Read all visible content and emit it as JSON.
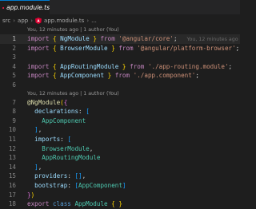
{
  "tab": {
    "filename": "app.module.ts"
  },
  "breadcrumb": {
    "parts": [
      "src",
      "app",
      "app.module.ts",
      "..."
    ]
  },
  "codelens": {
    "top": "You, 12 minutes ago | 1 author (You)",
    "middle": "You, 12 minutes ago | 1 author (You)"
  },
  "blame_inline": "You, 12 minutes ago",
  "lines": [
    {
      "n": "1",
      "tokens": [
        [
          "kw",
          "import"
        ],
        [
          "punc",
          " "
        ],
        [
          "br",
          "{"
        ],
        [
          "punc",
          " "
        ],
        [
          "id",
          "NgModule"
        ],
        [
          "punc",
          " "
        ],
        [
          "br",
          "}"
        ],
        [
          "punc",
          " "
        ],
        [
          "kw",
          "from"
        ],
        [
          "punc",
          " "
        ],
        [
          "str",
          "'@angular/core'"
        ],
        [
          "punc",
          ";"
        ]
      ]
    },
    {
      "n": "2",
      "tokens": [
        [
          "kw",
          "import"
        ],
        [
          "punc",
          " "
        ],
        [
          "br",
          "{"
        ],
        [
          "punc",
          " "
        ],
        [
          "id",
          "BrowserModule"
        ],
        [
          "punc",
          " "
        ],
        [
          "br",
          "}"
        ],
        [
          "punc",
          " "
        ],
        [
          "kw",
          "from"
        ],
        [
          "punc",
          " "
        ],
        [
          "str",
          "'@angular/platform-browser'"
        ],
        [
          "punc",
          ";"
        ]
      ]
    },
    {
      "n": "3",
      "tokens": []
    },
    {
      "n": "4",
      "tokens": [
        [
          "kw",
          "import"
        ],
        [
          "punc",
          " "
        ],
        [
          "br",
          "{"
        ],
        [
          "punc",
          " "
        ],
        [
          "id",
          "AppRoutingModule"
        ],
        [
          "punc",
          " "
        ],
        [
          "br",
          "}"
        ],
        [
          "punc",
          " "
        ],
        [
          "kw",
          "from"
        ],
        [
          "punc",
          " "
        ],
        [
          "str",
          "'./app-routing.module'"
        ],
        [
          "punc",
          ";"
        ]
      ]
    },
    {
      "n": "5",
      "tokens": [
        [
          "kw",
          "import"
        ],
        [
          "punc",
          " "
        ],
        [
          "br",
          "{"
        ],
        [
          "punc",
          " "
        ],
        [
          "id",
          "AppComponent"
        ],
        [
          "punc",
          " "
        ],
        [
          "br",
          "}"
        ],
        [
          "punc",
          " "
        ],
        [
          "kw",
          "from"
        ],
        [
          "punc",
          " "
        ],
        [
          "str",
          "'./app.component'"
        ],
        [
          "punc",
          ";"
        ]
      ]
    },
    {
      "n": "6",
      "tokens": []
    },
    {
      "n": "7",
      "tokens": [
        [
          "dec",
          "@NgModule"
        ],
        [
          "br",
          "("
        ],
        [
          "br2",
          "{"
        ]
      ]
    },
    {
      "n": "8",
      "tokens": [
        [
          "punc",
          "  "
        ],
        [
          "id",
          "declarations"
        ],
        [
          "punc",
          ": "
        ],
        [
          "br3",
          "["
        ]
      ]
    },
    {
      "n": "9",
      "tokens": [
        [
          "punc",
          "    "
        ],
        [
          "cls",
          "AppComponent"
        ]
      ]
    },
    {
      "n": "10",
      "tokens": [
        [
          "punc",
          "  "
        ],
        [
          "br3",
          "]"
        ],
        [
          "punc",
          ","
        ]
      ]
    },
    {
      "n": "11",
      "tokens": [
        [
          "punc",
          "  "
        ],
        [
          "id",
          "imports"
        ],
        [
          "punc",
          ": "
        ],
        [
          "br3",
          "["
        ]
      ]
    },
    {
      "n": "12",
      "tokens": [
        [
          "punc",
          "    "
        ],
        [
          "cls",
          "BrowserModule"
        ],
        [
          "punc",
          ","
        ]
      ]
    },
    {
      "n": "13",
      "tokens": [
        [
          "punc",
          "    "
        ],
        [
          "cls",
          "AppRoutingModule"
        ]
      ]
    },
    {
      "n": "14",
      "tokens": [
        [
          "punc",
          "  "
        ],
        [
          "br3",
          "]"
        ],
        [
          "punc",
          ","
        ]
      ]
    },
    {
      "n": "15",
      "tokens": [
        [
          "punc",
          "  "
        ],
        [
          "id",
          "providers"
        ],
        [
          "punc",
          ": "
        ],
        [
          "br3",
          "["
        ],
        [
          "br3",
          "]"
        ],
        [
          "punc",
          ","
        ]
      ]
    },
    {
      "n": "16",
      "tokens": [
        [
          "punc",
          "  "
        ],
        [
          "id",
          "bootstrap"
        ],
        [
          "punc",
          ": "
        ],
        [
          "br3",
          "["
        ],
        [
          "cls",
          "AppComponent"
        ],
        [
          "br3",
          "]"
        ]
      ]
    },
    {
      "n": "17",
      "tokens": [
        [
          "br2",
          "}"
        ],
        [
          "br",
          ")"
        ]
      ]
    },
    {
      "n": "18",
      "tokens": [
        [
          "kw",
          "export"
        ],
        [
          "punc",
          " "
        ],
        [
          "kw2",
          "class"
        ],
        [
          "punc",
          " "
        ],
        [
          "cls",
          "AppModule"
        ],
        [
          "punc",
          " "
        ],
        [
          "br",
          "{"
        ],
        [
          "punc",
          " "
        ],
        [
          "br",
          "}"
        ]
      ]
    }
  ]
}
